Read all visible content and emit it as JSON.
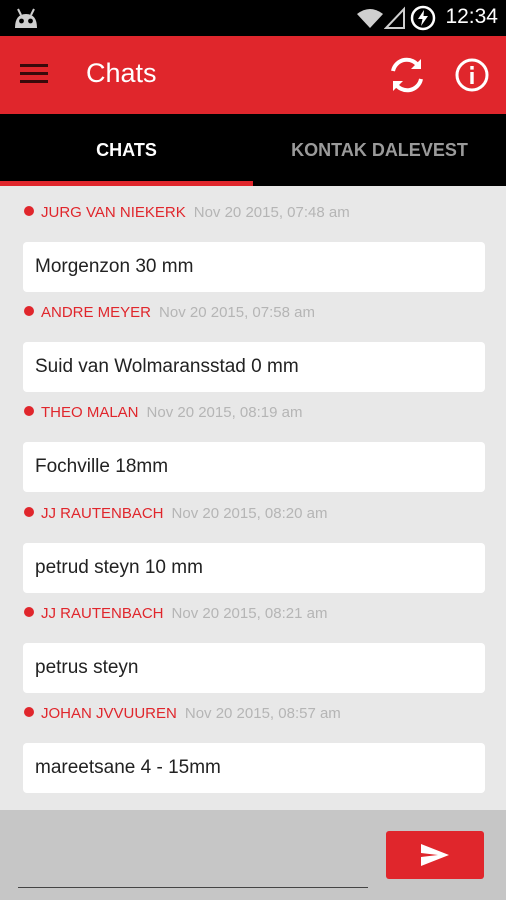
{
  "status_bar": {
    "time": "12:34",
    "icons": [
      "android-icon",
      "wifi-icon",
      "signal-icon",
      "battery-icon"
    ]
  },
  "app_bar": {
    "title": "Chats",
    "icons": [
      "menu-icon",
      "refresh-icon",
      "info-icon"
    ],
    "accent_color": "#e0262c"
  },
  "tabs": [
    {
      "label": "CHATS",
      "active": true
    },
    {
      "label": "KONTAK DALEVEST",
      "active": false
    }
  ],
  "messages": [
    {
      "sender": "JURG VAN NIEKERK",
      "time": "Nov 20 2015, 07:48 am",
      "text": "Morgenzon 30 mm"
    },
    {
      "sender": "ANDRE MEYER",
      "time": "Nov 20 2015, 07:58 am",
      "text": "Suid van Wolmaransstad 0 mm"
    },
    {
      "sender": "THEO MALAN",
      "time": "Nov 20 2015, 08:19 am",
      "text": "Fochville 18mm"
    },
    {
      "sender": "JJ RAUTENBACH",
      "time": "Nov 20 2015, 08:20 am",
      "text": "petrud steyn 10 mm"
    },
    {
      "sender": "JJ RAUTENBACH",
      "time": "Nov 20 2015, 08:21 am",
      "text": "petrus steyn"
    },
    {
      "sender": "JOHAN JVVUUREN",
      "time": "Nov 20 2015, 08:57 am",
      "text": "mareetsane 4 - 15mm"
    }
  ],
  "composer": {
    "input_value": "",
    "send_icon": "send-icon"
  }
}
